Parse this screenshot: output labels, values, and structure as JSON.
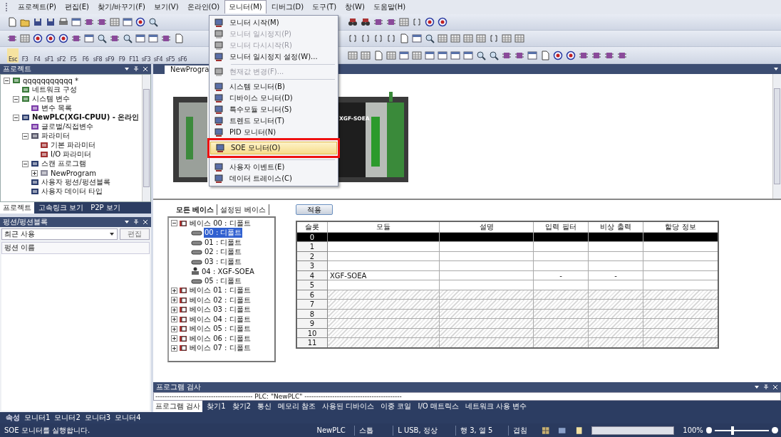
{
  "menu_bar": [
    {
      "label": "프로젝트(P)",
      "selected": false
    },
    {
      "label": "편집(E)",
      "selected": false
    },
    {
      "label": "찾기/바꾸기(F)",
      "selected": false
    },
    {
      "label": "보기(V)",
      "selected": false
    },
    {
      "label": "온라인(O)",
      "selected": false
    },
    {
      "label": "모니터(M)",
      "selected": true
    },
    {
      "label": "디버그(D)",
      "selected": false
    },
    {
      "label": "도구(T)",
      "selected": false
    },
    {
      "label": "창(W)",
      "selected": false
    },
    {
      "label": "도움말(H)",
      "selected": false
    }
  ],
  "toolbar": {
    "fkeys": [
      "Esc",
      "F3",
      "F4",
      "sF1",
      "sF2",
      "F5",
      "F6",
      "sF8",
      "sF9",
      "F9",
      "F11",
      "sF3",
      "sF4",
      "sF5",
      "sF6"
    ]
  },
  "dropdown": [
    {
      "kind": "item",
      "label": "모니터 시작(M)",
      "disabled": false,
      "selected": false
    },
    {
      "kind": "item",
      "label": "모니터 일시정지(P)",
      "disabled": true,
      "selected": false
    },
    {
      "kind": "item",
      "label": "모니터 다시시작(R)",
      "disabled": true,
      "selected": false
    },
    {
      "kind": "item",
      "label": "모니터 일시정지 설정(W)...",
      "disabled": false,
      "selected": false
    },
    {
      "kind": "separator"
    },
    {
      "kind": "item",
      "label": "현재값 변경(F)...",
      "disabled": true,
      "selected": false
    },
    {
      "kind": "separator"
    },
    {
      "kind": "item",
      "label": "시스템 모니터(B)",
      "disabled": false,
      "selected": false
    },
    {
      "kind": "item",
      "label": "디바이스 모니터(D)",
      "disabled": false,
      "selected": false
    },
    {
      "kind": "item",
      "label": "특수모듈 모니터(S)",
      "disabled": false,
      "selected": false
    },
    {
      "kind": "item",
      "label": "트렌드 모니터(T)",
      "disabled": false,
      "selected": false
    },
    {
      "kind": "item",
      "label": "PID 모니터(N)",
      "disabled": false,
      "selected": false
    },
    {
      "kind": "item",
      "label": "SOE 모니터(O)",
      "disabled": false,
      "selected": true
    },
    {
      "kind": "separator"
    },
    {
      "kind": "item",
      "label": "사용자 이벤트(E)",
      "disabled": false,
      "selected": false
    },
    {
      "kind": "item",
      "label": "데이터 트레이스(C)",
      "disabled": false,
      "selected": false
    }
  ],
  "project_panel": {
    "title": "프로젝트",
    "tree": [
      {
        "label": "qqqqqqqqqqq *",
        "kind": "network",
        "expanded": true,
        "children": [
          {
            "label": "네트워크 구성",
            "kind": "network"
          },
          {
            "label": "시스템 변수",
            "kind": "network",
            "expanded": true,
            "children": [
              {
                "label": "변수 목록",
                "kind": "variable"
              }
            ]
          },
          {
            "label": "NewPLC(XGI-CPUU) - 온라인",
            "kind": "plc",
            "expanded": true,
            "children": [
              {
                "label": "글로벌/직접변수",
                "kind": "variable"
              },
              {
                "label": "파라미터",
                "kind": "params",
                "expanded": true,
                "children": [
                  {
                    "label": "기본 파라미터",
                    "kind": "param"
                  },
                  {
                    "label": "I/O 파라미터",
                    "kind": "param"
                  }
                ]
              },
              {
                "label": "스캔 프로그램",
                "kind": "plc",
                "expanded": true,
                "children": [
                  {
                    "label": "NewProgram",
                    "kind": "program",
                    "expanded": false
                  }
                ]
              },
              {
                "label": "사용자 펑션/펑션블록",
                "kind": "plc"
              },
              {
                "label": "사용자 데이터 타입",
                "kind": "plc"
              }
            ]
          }
        ]
      }
    ],
    "tabs": [
      {
        "label": "프로젝트",
        "selected": true
      },
      {
        "label": "고속링크 보기",
        "selected": false
      },
      {
        "label": "P2P 보기",
        "selected": false
      }
    ]
  },
  "function_panel": {
    "title": "펑션/펑션블록",
    "combo": "최근 사용",
    "edit_button": "편집",
    "list_header": "펑션 이름"
  },
  "doc_tab": "NewProgra",
  "rack_label": "XGF-SOEA",
  "base_tabs": [
    {
      "label": "모든 베이스",
      "selected": true
    },
    {
      "label": "설정된 베이스",
      "selected": false
    }
  ],
  "base_tree": [
    {
      "label": "베이스 00 : 디폴트",
      "expanded": true,
      "selected": false,
      "children": [
        {
          "label": "00 : 디폴트",
          "kind": "slot",
          "selected": true
        },
        {
          "label": "01 : 디폴트",
          "kind": "slot",
          "selected": false
        },
        {
          "label": "02 : 디폴트",
          "kind": "slot",
          "selected": false
        },
        {
          "label": "03 : 디폴트",
          "kind": "slot",
          "selected": false
        },
        {
          "label": "04 : XGF-SOEA",
          "kind": "module",
          "selected": false
        },
        {
          "label": "05 : 디폴트",
          "kind": "slot",
          "selected": false
        }
      ]
    },
    {
      "label": "베이스 01 : 디폴트",
      "expanded": false,
      "selected": false
    },
    {
      "label": "베이스 02 : 디폴트",
      "expanded": false,
      "selected": false
    },
    {
      "label": "베이스 03 : 디폴트",
      "expanded": false,
      "selected": false
    },
    {
      "label": "베이스 04 : 디폴트",
      "expanded": false,
      "selected": false
    },
    {
      "label": "베이스 05 : 디폴트",
      "expanded": false,
      "selected": false
    },
    {
      "label": "베이스 06 : 디폴트",
      "expanded": false,
      "selected": false
    },
    {
      "label": "베이스 07 : 디폴트",
      "expanded": false,
      "selected": false
    }
  ],
  "apply_button": "적용",
  "table": {
    "columns": [
      "슬롯",
      "모듈",
      "설명",
      "입력 필터",
      "비상 출력",
      "할당 정보"
    ],
    "rows": [
      {
        "slot": "0",
        "selected": true,
        "disabled": false
      },
      {
        "slot": "1",
        "selected": false,
        "disabled": false
      },
      {
        "slot": "2",
        "selected": false,
        "disabled": false
      },
      {
        "slot": "3",
        "selected": false,
        "disabled": false
      },
      {
        "slot": "4",
        "module": "XGF-SOEA",
        "input_filter": "-",
        "emergency_output": "-",
        "selected": false,
        "disabled": false
      },
      {
        "slot": "5",
        "selected": false,
        "disabled": false
      },
      {
        "slot": "6",
        "selected": false,
        "disabled": true
      },
      {
        "slot": "7",
        "selected": false,
        "disabled": true
      },
      {
        "slot": "8",
        "selected": false,
        "disabled": true
      },
      {
        "slot": "9",
        "selected": false,
        "disabled": true
      },
      {
        "slot": "10",
        "selected": false,
        "disabled": true
      },
      {
        "slot": "11",
        "selected": false,
        "disabled": true
      }
    ]
  },
  "check_panel": {
    "title": "프로그램 검사",
    "output": "------------------------------------------ PLC: \"NewPLC\" ------------------------------------------",
    "tabs": [
      {
        "label": "프로그램 검사",
        "selected": true
      },
      {
        "label": "찾기1",
        "selected": false
      },
      {
        "label": "찾기2",
        "selected": false
      },
      {
        "label": "통신",
        "selected": false
      },
      {
        "label": "메모리 참조",
        "selected": false
      },
      {
        "label": "사용된 디바이스",
        "selected": false
      },
      {
        "label": "이중 코일",
        "selected": false
      },
      {
        "label": "I/O 매트릭스",
        "selected": false
      },
      {
        "label": "네트워크 사용 변수",
        "selected": false
      }
    ]
  },
  "bottom_tabs": [
    {
      "label": "속성",
      "selected": true
    },
    {
      "label": "모니터1",
      "selected": false
    },
    {
      "label": "모니터2",
      "selected": false
    },
    {
      "label": "모니터3",
      "selected": false
    },
    {
      "label": "모니터4",
      "selected": false
    }
  ],
  "status_bar": {
    "message": "SOE 모니터를 실행합니다.",
    "project": "NewPLC",
    "mode": "스톱",
    "connection": "L USB, 정상",
    "position": "행 3, 열 5",
    "insert_mode": "겹침",
    "zoom": "100%",
    "zoom_slider": {
      "level": 0.3
    }
  }
}
